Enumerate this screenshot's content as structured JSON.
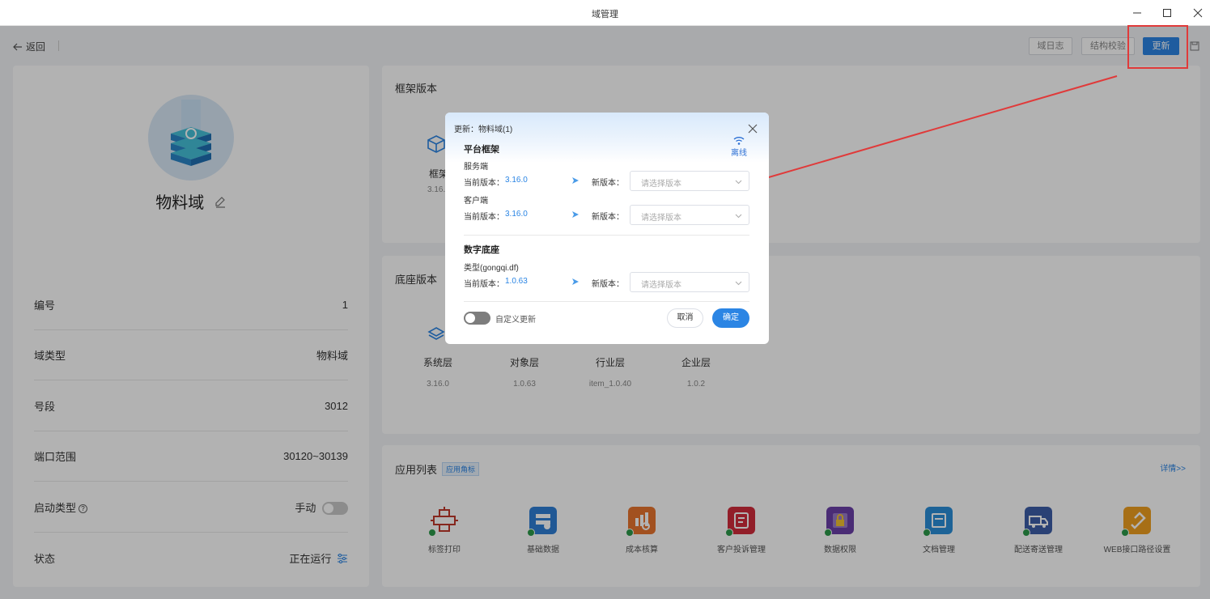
{
  "window": {
    "title": "域管理"
  },
  "toolbar": {
    "back_label": "返回",
    "log_label": "域日志",
    "check_label": "结构校验",
    "update_label": "更新"
  },
  "domain": {
    "name": "物料域",
    "fields": [
      {
        "label": "编号",
        "value": "1"
      },
      {
        "label": "域类型",
        "value": "物料域"
      },
      {
        "label": "号段",
        "value": "3012"
      },
      {
        "label": "端口范围",
        "value": "30120~30139"
      },
      {
        "label": "启动类型",
        "value": "手动"
      },
      {
        "label": "状态",
        "value": "正在运行"
      }
    ]
  },
  "framework": {
    "title": "框架版本",
    "partial_label": "框架",
    "partial_version": "3.16."
  },
  "base": {
    "title": "底座版本",
    "layers": [
      {
        "name": "系统层",
        "version": "3.16.0"
      },
      {
        "name": "对象层",
        "version": "1.0.63"
      },
      {
        "name": "行业层",
        "version": "item_1.0.40"
      },
      {
        "name": "企业层",
        "version": "1.0.2"
      }
    ]
  },
  "apps": {
    "title": "应用列表",
    "tag": "应用角标",
    "detail_link": "详情>>",
    "items": [
      {
        "label": "标签打印",
        "icon": "label-print-icon",
        "color": "#c0392b"
      },
      {
        "label": "基础数据",
        "icon": "basic-data-icon",
        "color": "#2f7fd6"
      },
      {
        "label": "成本核算",
        "icon": "cost-accounting-icon",
        "color": "#e8742f"
      },
      {
        "label": "客户投诉管理",
        "icon": "complaint-icon",
        "color": "#d12c3c"
      },
      {
        "label": "数据权限",
        "icon": "data-permission-icon",
        "color": "#6b3fa8"
      },
      {
        "label": "文档管理",
        "icon": "document-icon",
        "color": "#2a8fd8"
      },
      {
        "label": "配送寄送管理",
        "icon": "delivery-icon",
        "color": "#3d5ea8"
      },
      {
        "label": "WEB接口路径设置",
        "icon": "web-interface-icon",
        "color": "#f0a020"
      }
    ]
  },
  "dialog": {
    "title": "更新：物料域(1)",
    "offline_label": "离线",
    "platform": {
      "title": "平台框架",
      "server_label": "服务端",
      "client_label": "客户端",
      "server": {
        "current_label": "当前版本：",
        "current_value": "3.16.0",
        "new_label": "新版本：",
        "placeholder": "请选择版本"
      },
      "client": {
        "current_label": "当前版本：",
        "current_value": "3.16.0",
        "new_label": "新版本：",
        "placeholder": "请选择版本"
      }
    },
    "digital_base": {
      "title": "数字底座",
      "type_label": "类型(gongqi.df)",
      "row": {
        "current_label": "当前版本：",
        "current_value": "1.0.63",
        "new_label": "新版本：",
        "placeholder": "请选择版本"
      }
    },
    "custom_update_label": "自定义更新",
    "custom_update_on": false,
    "cancel_label": "取消",
    "ok_label": "确定"
  },
  "colors": {
    "accent": "#2b85e4",
    "highlight": "#e03a3a"
  }
}
